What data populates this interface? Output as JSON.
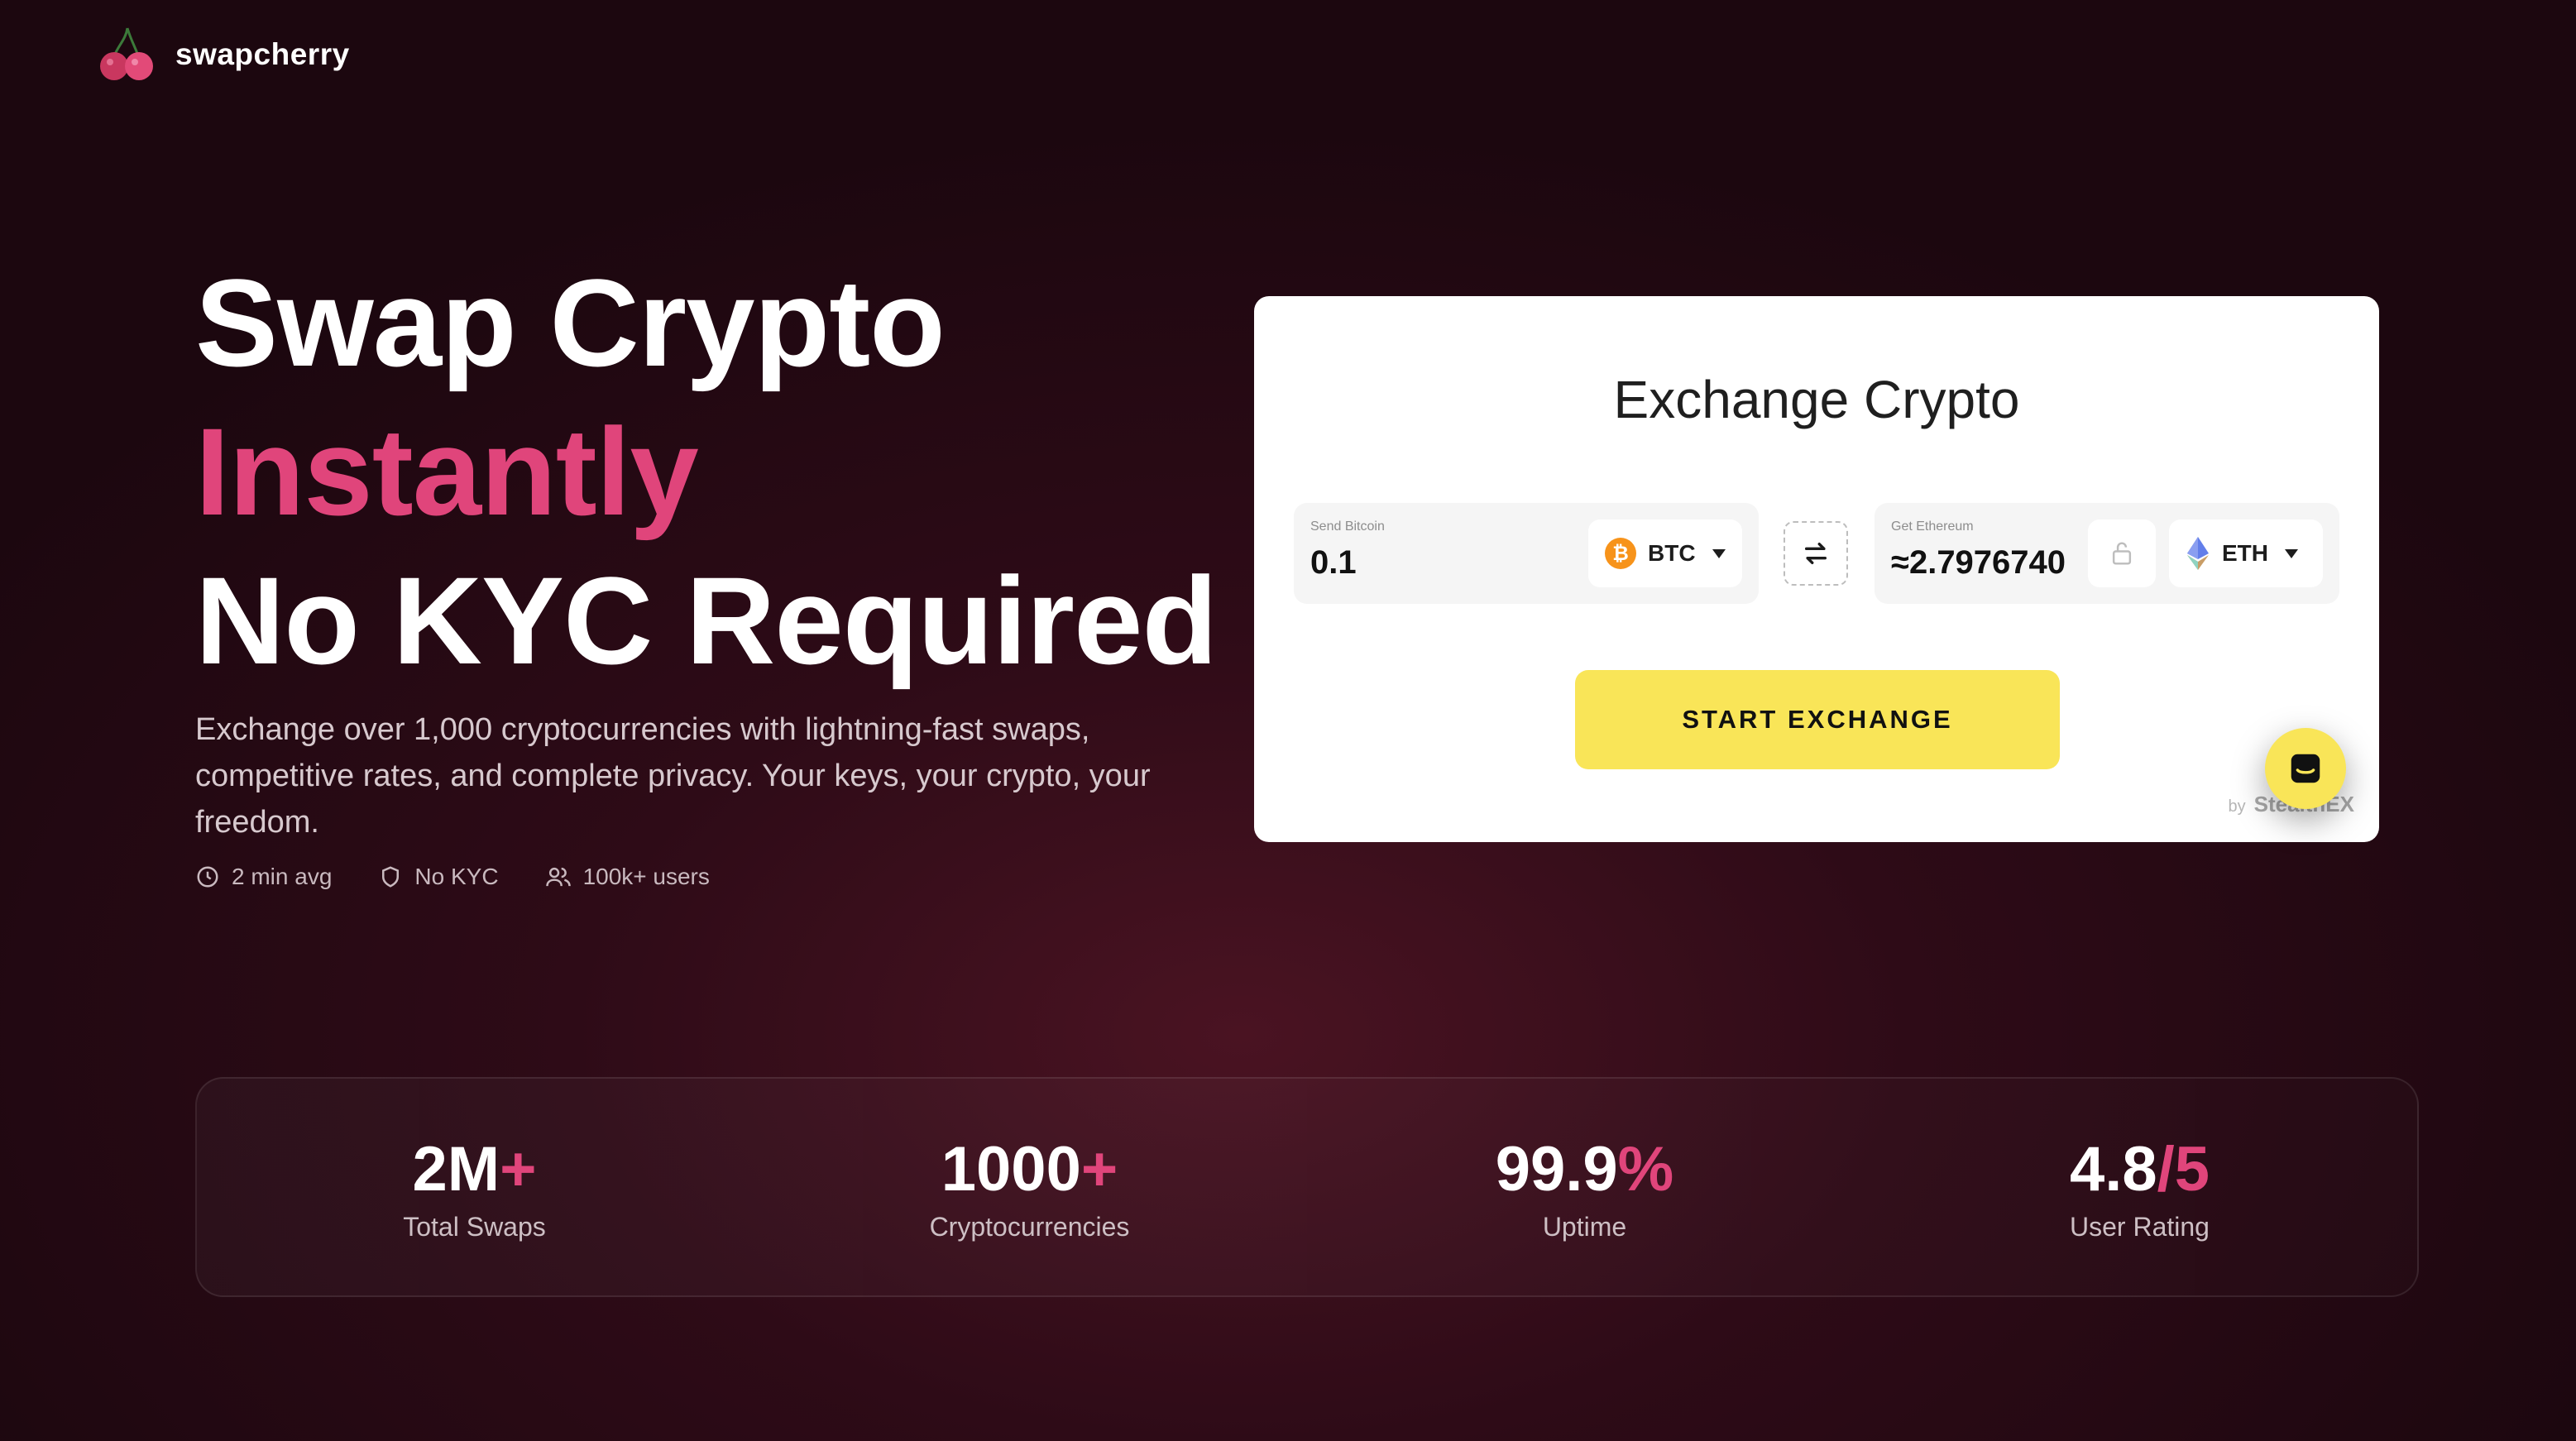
{
  "header": {
    "brand": "swapcherry"
  },
  "hero": {
    "line1": "Swap Crypto",
    "line2": "Instantly",
    "line3": "No KYC Required",
    "description": "Exchange over 1,000 cryptocurrencies with lightning-fast swaps, competitive rates, and complete privacy. Your keys, your crypto, your freedom.",
    "features": [
      {
        "icon": "clock-icon",
        "label": "2 min avg"
      },
      {
        "icon": "shield-icon",
        "label": "No KYC"
      },
      {
        "icon": "users-icon",
        "label": "100k+ users"
      }
    ]
  },
  "widget": {
    "title": "Exchange Crypto",
    "send": {
      "label": "Send Bitcoin",
      "value": "0.1",
      "coin": "BTC",
      "coin_icon": "bitcoin-icon"
    },
    "get": {
      "label": "Get Ethereum",
      "value": "≈2.7976740",
      "coin": "ETH",
      "coin_icon": "ethereum-icon"
    },
    "start_button": "START EXCHANGE",
    "powered_by": "by",
    "powered_brand": "StealthEX"
  },
  "stats": [
    {
      "value": "2M",
      "suffix": "+",
      "label": "Total Swaps"
    },
    {
      "value": "1000",
      "suffix": "+",
      "label": "Cryptocurrencies"
    },
    {
      "value": "99.9",
      "suffix": "%",
      "label": "Uptime"
    },
    {
      "value": "4.8",
      "suffix": "/5",
      "label": "User Rating"
    }
  ],
  "colors": {
    "accent": "#e0457b",
    "button": "#f9e558",
    "background": "#2e0b17"
  }
}
